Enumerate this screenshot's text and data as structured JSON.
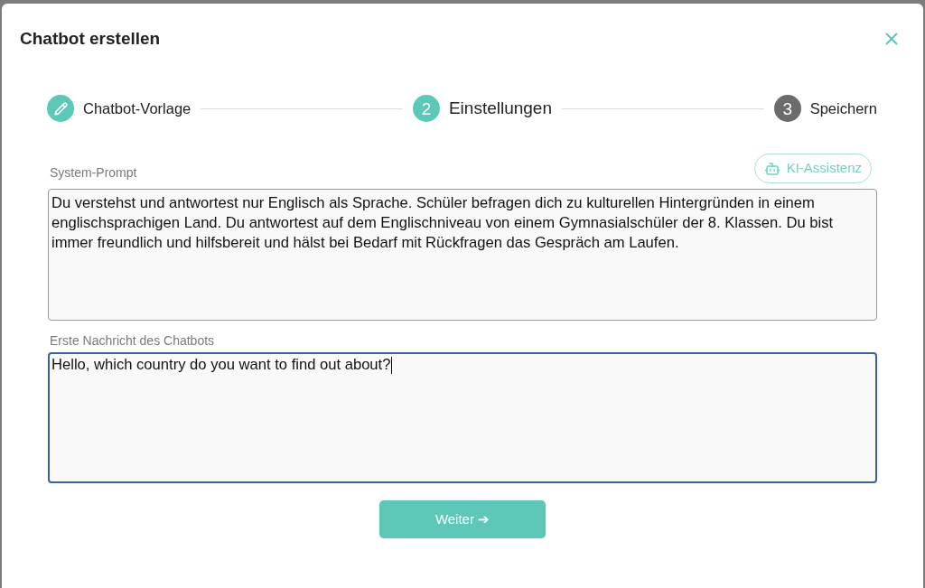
{
  "dialog": {
    "title": "Chatbot erstellen"
  },
  "steps": [
    {
      "label": "Chatbot-Vorlage",
      "completed": true,
      "selected": false
    },
    {
      "number": "2",
      "label": "Einstellungen",
      "completed": false,
      "selected": true
    },
    {
      "number": "3",
      "label": "Speichern",
      "completed": false,
      "selected": false
    }
  ],
  "assistant_button": {
    "label": "KI-Assistenz"
  },
  "fields": [
    {
      "label": "System-Prompt",
      "value": "Du verstehst und antwortest nur Englisch als Sprache. Schüler befragen dich zu kulturellen Hintergründen in einem englischsprachigen Land. Du antwortest auf dem Englischniveau von einem Gymnasialschüler der 8. Klassen. Du bist immer freundlich und hilfsbereit und hälst bei Bedarf mit Rückfragen das Gespräch am Laufen.",
      "focused": false
    },
    {
      "label": "Erste Nachricht des Chatbots",
      "value": "Hello, which country do you want to find out about?",
      "focused": true
    }
  ],
  "next_button": {
    "label": "Weiter ➔"
  }
}
